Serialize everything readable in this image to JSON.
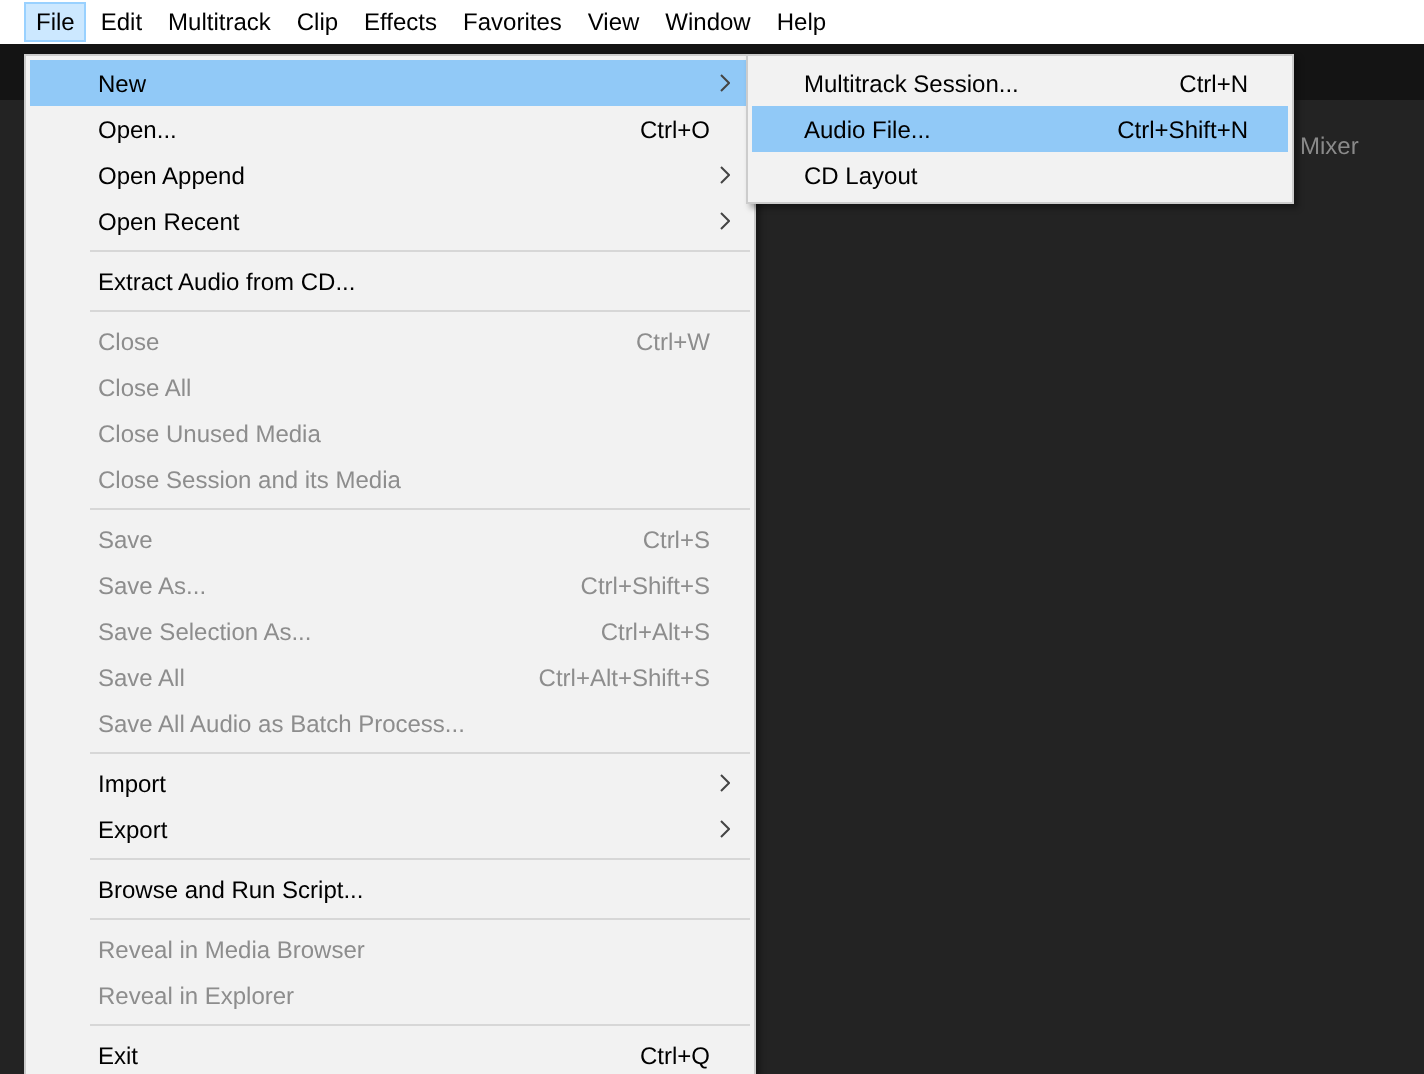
{
  "menubar": [
    {
      "label": "File",
      "selected": true
    },
    {
      "label": "Edit",
      "selected": false
    },
    {
      "label": "Multitrack",
      "selected": false
    },
    {
      "label": "Clip",
      "selected": false
    },
    {
      "label": "Effects",
      "selected": false
    },
    {
      "label": "Favorites",
      "selected": false
    },
    {
      "label": "View",
      "selected": false
    },
    {
      "label": "Window",
      "selected": false
    },
    {
      "label": "Help",
      "selected": false
    }
  ],
  "file_menu": [
    {
      "kind": "item",
      "label": "New",
      "submenu": true,
      "disabled": false,
      "selected": true
    },
    {
      "kind": "item",
      "label": "Open...",
      "shortcut": "Ctrl+O",
      "disabled": false,
      "selected": false
    },
    {
      "kind": "item",
      "label": "Open Append",
      "submenu": true,
      "disabled": false,
      "selected": false
    },
    {
      "kind": "item",
      "label": "Open Recent",
      "submenu": true,
      "disabled": false,
      "selected": false
    },
    {
      "kind": "separator"
    },
    {
      "kind": "item",
      "label": "Extract Audio from CD...",
      "disabled": false,
      "selected": false
    },
    {
      "kind": "separator"
    },
    {
      "kind": "item",
      "label": "Close",
      "shortcut": "Ctrl+W",
      "disabled": true,
      "selected": false
    },
    {
      "kind": "item",
      "label": "Close All",
      "disabled": true,
      "selected": false
    },
    {
      "kind": "item",
      "label": "Close Unused Media",
      "disabled": true,
      "selected": false
    },
    {
      "kind": "item",
      "label": "Close Session and its Media",
      "disabled": true,
      "selected": false
    },
    {
      "kind": "separator"
    },
    {
      "kind": "item",
      "label": "Save",
      "shortcut": "Ctrl+S",
      "disabled": true,
      "selected": false
    },
    {
      "kind": "item",
      "label": "Save As...",
      "shortcut": "Ctrl+Shift+S",
      "disabled": true,
      "selected": false
    },
    {
      "kind": "item",
      "label": "Save Selection As...",
      "shortcut": "Ctrl+Alt+S",
      "disabled": true,
      "selected": false
    },
    {
      "kind": "item",
      "label": "Save All",
      "shortcut": "Ctrl+Alt+Shift+S",
      "disabled": true,
      "selected": false
    },
    {
      "kind": "item",
      "label": "Save All Audio as Batch Process...",
      "disabled": true,
      "selected": false
    },
    {
      "kind": "separator"
    },
    {
      "kind": "item",
      "label": "Import",
      "submenu": true,
      "disabled": false,
      "selected": false
    },
    {
      "kind": "item",
      "label": "Export",
      "submenu": true,
      "disabled": false,
      "selected": false
    },
    {
      "kind": "separator"
    },
    {
      "kind": "item",
      "label": "Browse and Run Script...",
      "disabled": false,
      "selected": false
    },
    {
      "kind": "separator"
    },
    {
      "kind": "item",
      "label": "Reveal in Media Browser",
      "disabled": true,
      "selected": false
    },
    {
      "kind": "item",
      "label": "Reveal in Explorer",
      "disabled": true,
      "selected": false
    },
    {
      "kind": "separator"
    },
    {
      "kind": "item",
      "label": "Exit",
      "shortcut": "Ctrl+Q",
      "disabled": false,
      "selected": false
    }
  ],
  "new_submenu": [
    {
      "label": "Multitrack Session...",
      "shortcut": "Ctrl+N",
      "selected": false
    },
    {
      "label": "Audio File...",
      "shortcut": "Ctrl+Shift+N",
      "selected": true
    },
    {
      "label": "CD Layout",
      "selected": false
    }
  ],
  "panel": {
    "tab": "Mixer"
  }
}
